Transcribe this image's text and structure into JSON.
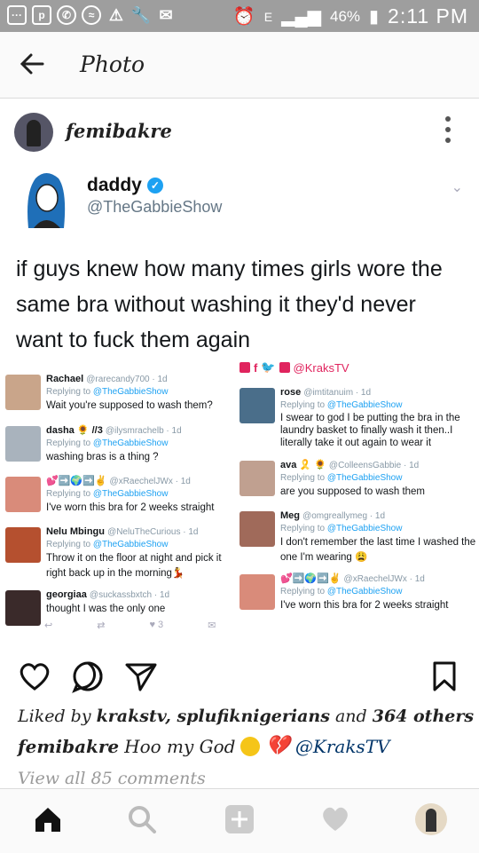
{
  "status_bar": {
    "battery": "46%",
    "time": "2:11 PM",
    "network": "E"
  },
  "app_bar": {
    "title": "Photo"
  },
  "post": {
    "username": "femibakre"
  },
  "tweet": {
    "name": "daddy",
    "handle": "@TheGabbieShow",
    "text": "if guys knew how many times girls wore the same bra without washing it they'd never want to fuck them again",
    "watermark": "@KraksTV",
    "replies_left": [
      {
        "name": "Rachael",
        "handle": "@rarecandy700 · 1d",
        "replying": "Replying to",
        "to": "@TheGabbieShow",
        "lines": [
          "Wait you're supposed to wash them?"
        ]
      },
      {
        "name": "dasha 🌻 //3",
        "handle": "@ilysmrachelb · 1d",
        "replying": "Replying to",
        "to": "@TheGabbieShow",
        "lines": [
          "washing bras is a thing ?"
        ]
      },
      {
        "name": "💕➡️🌍➡️✌️",
        "handle": "@xRaechelJWx · 1d",
        "replying": "Replying to",
        "to": "@TheGabbieShow",
        "lines": [
          "I've worn this bra for 2 weeks straight"
        ]
      },
      {
        "name": "Nelu Mbingu",
        "handle": "@NeluTheCurious · 1d",
        "replying": "Replying to",
        "to": "@TheGabbieShow",
        "lines": [
          "Throw it on the floor at night and pick it",
          "right back up in the morning💃"
        ]
      },
      {
        "name": "georgiaa",
        "handle": "@suckassbxtch · 1d",
        "replying": "",
        "to": "",
        "lines": [
          "thought I was the only one"
        ]
      }
    ],
    "replies_right": [
      {
        "name": "rose",
        "handle": "@imtitanuim · 1d",
        "replying": "Replying to",
        "to": "@TheGabbieShow",
        "lines": [
          "I swear to god I be putting the bra in the",
          "laundry basket to finally wash it then..I",
          "literally take it out again to wear it"
        ]
      },
      {
        "name": "ava 🎗️ 🌻",
        "handle": "@ColleensGabbie · 1d",
        "replying": "Replying to",
        "to": "@TheGabbieShow",
        "lines": [
          "are you supposed to wash them"
        ]
      },
      {
        "name": "Meg",
        "handle": "@omgreallymeg · 1d",
        "replying": "Replying to",
        "to": "@TheGabbieShow",
        "lines": [
          "I don't remember the last time I washed the",
          "one I'm wearing 😩"
        ]
      },
      {
        "name": "💕➡️🌍➡️✌️",
        "handle": "@xRaechelJWx · 1d",
        "replying": "Replying to",
        "to": "@TheGabbieShow",
        "lines": [
          "I've worn this bra for 2 weeks straight"
        ]
      }
    ],
    "mini_actions": {
      "likes": "3"
    }
  },
  "engagement": {
    "liked_by_prefix": "Liked by",
    "liked_by_users": "krakstv, splufiknigerians",
    "liked_by_and": "and",
    "liked_by_count": "364 others",
    "caption_user": "femibakre",
    "caption_text": "Hoo my God",
    "caption_mention": "@KraksTV",
    "view_all": "View all 85 comments"
  },
  "icons": [
    "home-icon",
    "search-icon",
    "add-icon",
    "heart-icon",
    "profile-icon"
  ]
}
